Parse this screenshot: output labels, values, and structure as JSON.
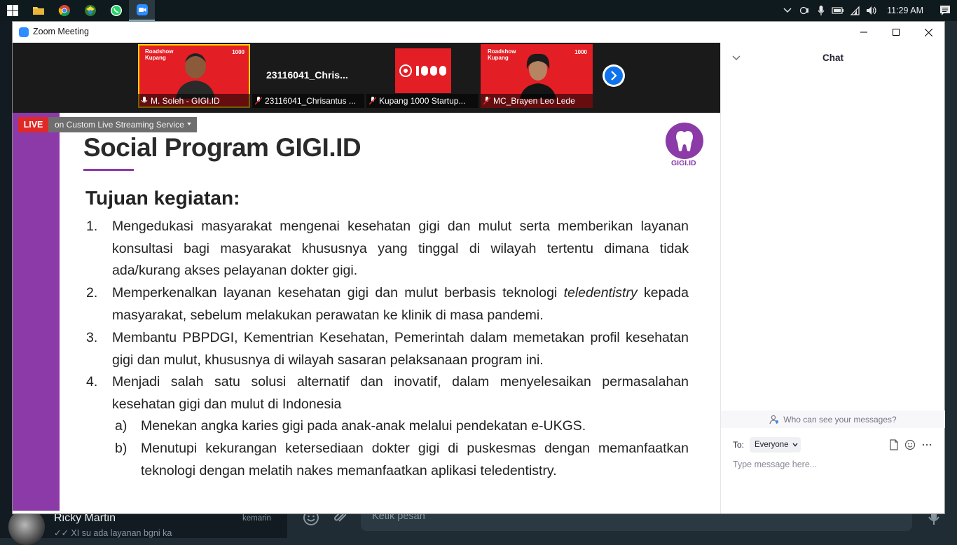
{
  "taskbar": {
    "apps": [
      "windows-start",
      "file-explorer",
      "chrome",
      "maps-app",
      "whatsapp",
      "zoom"
    ],
    "clock": "11:29 AM"
  },
  "zoom": {
    "window_title": "Zoom Meeting",
    "participants": [
      {
        "name": "M. Soleh - GIGI.ID",
        "tag": "Roadshow\nKupang",
        "brand": "1000"
      },
      {
        "name": "23116041_Chrisantus ...",
        "display": "23116041_Chris..."
      },
      {
        "name": "Kupang 1000 Startup..."
      },
      {
        "name": "MC_Brayen Leo Lede",
        "tag": "Roadshow\nKupang",
        "brand": "1000"
      }
    ],
    "live": {
      "badge": "LIVE",
      "service": "on Custom Live Streaming Service"
    }
  },
  "slide": {
    "title": "Social Program GIGI.ID",
    "logo_text": "GIGI.ID",
    "subtitle": "Tujuan kegiatan:",
    "items": [
      {
        "num": "1.",
        "text": "Mengedukasi masyarakat mengenai kesehatan gigi dan mulut serta memberikan layanan konsultasi bagi masyarakat khususnya yang tinggal di wilayah tertentu dimana tidak ada/kurang akses pelayanan dokter gigi."
      },
      {
        "num": "2.",
        "text_before": "Memperkenalkan layanan kesehatan gigi dan mulut berbasis teknologi ",
        "text_italic": "teledentistry",
        "text_after": " kepada masyarakat, sebelum melakukan perawatan ke klinik di masa pandemi."
      },
      {
        "num": "3.",
        "text": "Membantu PBPDGI, Kementrian Kesehatan, Pemerintah dalam memetakan profil kesehatan gigi dan mulut, khususnya di wilayah sasaran pelaksanaan program ini."
      },
      {
        "num": "4.",
        "text": "Menjadi salah satu solusi alternatif dan inovatif, dalam menyelesaikan permasalahan kesehatan gigi dan mulut di Indonesia"
      },
      {
        "num": "a)",
        "text": "Menekan angka karies gigi pada anak-anak melalui pendekatan e-UKGS."
      },
      {
        "num": "b)",
        "text": "Menutupi kekurangan ketersediaan dokter gigi di puskesmas dengan memanfaatkan teknologi dengan melatih nakes memanfaatkan aplikasi teledentistry."
      }
    ]
  },
  "chat": {
    "title": "Chat",
    "who_can_see": "Who can see your messages?",
    "to_label": "To:",
    "to_value": "Everyone",
    "placeholder": "Type message here..."
  },
  "whatsapp": {
    "contact_name": "Ricky Martin",
    "contact_time": "kemarin",
    "last_message": "✓✓ XI su ada layanan bgni ka",
    "input_placeholder": "Ketik pesan"
  },
  "colors": {
    "zoom_blue": "#2d8cff",
    "live_red": "#e02828",
    "gigi_purple": "#8b3aa8"
  }
}
